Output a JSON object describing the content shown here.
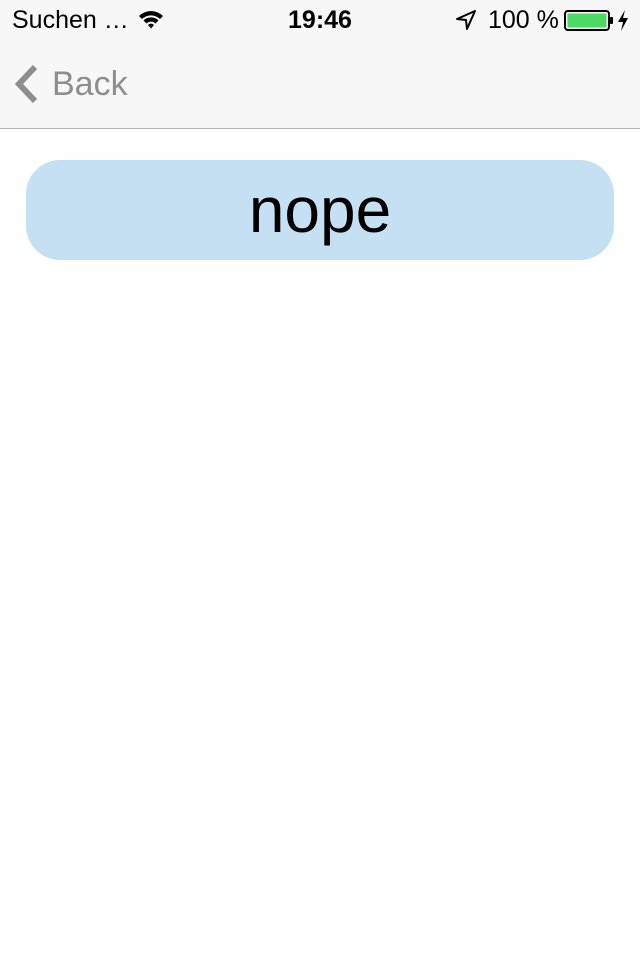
{
  "status_bar": {
    "carrier": "Suchen …",
    "time": "19:46",
    "battery_percent": "100 %",
    "battery_level": 1.0,
    "charging": true,
    "icons": [
      "wifi-icon",
      "location-arrow-icon",
      "battery-icon",
      "charging-bolt-icon"
    ]
  },
  "nav_bar": {
    "back_label": "Back",
    "back_icon": "chevron-left-icon"
  },
  "main": {
    "button_label": "nope"
  },
  "colors": {
    "bar_background": "#f7f7f7",
    "back_tint": "#8e8e8e",
    "button_background": "#c5e0f3",
    "battery_fill": "#4cd964"
  }
}
